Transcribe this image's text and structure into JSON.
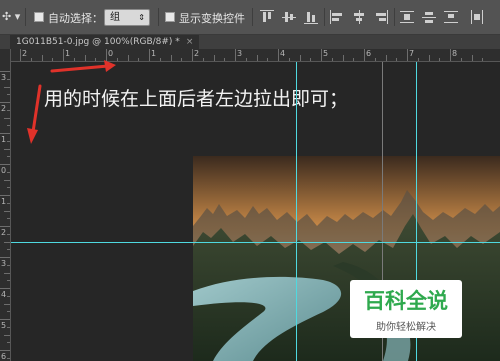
{
  "options_bar": {
    "move_tool_icon": "move-arrow-icon",
    "auto_select_label": "自动选择：",
    "auto_select_value": "组",
    "show_transform_label": "显示变换控件"
  },
  "document_tab": {
    "title": "1G011B51-0.jpg @ 100%(RGB/8#) *",
    "close": "×"
  },
  "ruler_top": {
    "labels": [
      "2",
      "1",
      "0",
      "1",
      "2",
      "3",
      "4",
      "5",
      "6",
      "7",
      "8"
    ]
  },
  "ruler_left": {
    "labels": [
      "3",
      "2",
      "1",
      "0",
      "1",
      "2",
      "3",
      "4",
      "5",
      "6"
    ]
  },
  "canvas": {
    "instruction": "用的时候在上面后者左边拉出即可；",
    "guide_color": "#4fd9e0",
    "arrow_color": "#e0322a"
  },
  "watermark": {
    "main": "百科全说",
    "sub": "助你轻松解决",
    "color": "#2fa94e"
  }
}
